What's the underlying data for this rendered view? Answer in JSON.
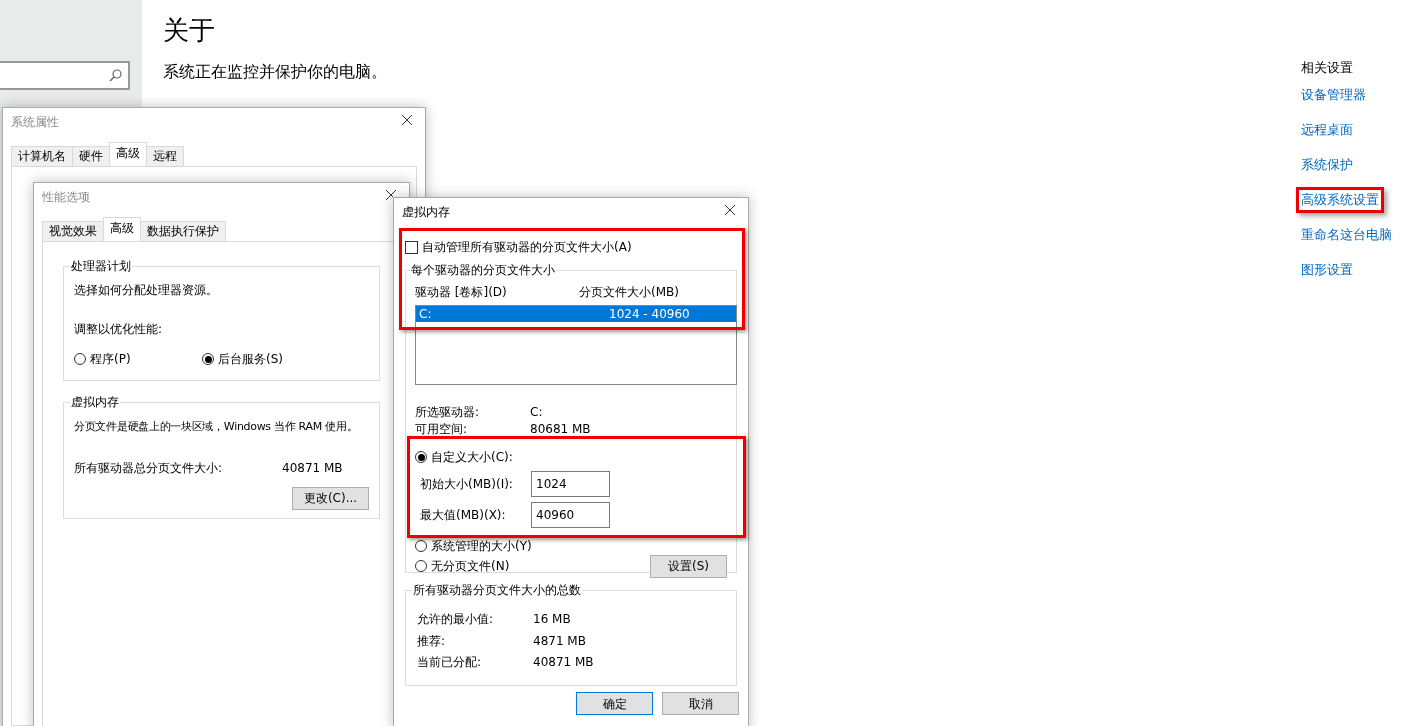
{
  "settings": {
    "title": "关于",
    "subtitle": "系统正在监控并保护你的电脑。",
    "related": {
      "heading": "相关设置",
      "links": [
        {
          "label": "设备管理器",
          "highlighted": false
        },
        {
          "label": "远程桌面",
          "highlighted": false
        },
        {
          "label": "系统保护",
          "highlighted": false
        },
        {
          "label": "高级系统设置",
          "highlighted": true
        },
        {
          "label": "重命名这台电脑",
          "highlighted": false
        },
        {
          "label": "图形设置",
          "highlighted": false
        }
      ]
    }
  },
  "system_properties": {
    "title": "系统属性",
    "tabs": [
      {
        "label": "计算机名",
        "selected": false
      },
      {
        "label": "硬件",
        "selected": false
      },
      {
        "label": "高级",
        "selected": true
      },
      {
        "label": "远程",
        "selected": false
      }
    ]
  },
  "performance_options": {
    "title": "性能选项",
    "tabs": [
      {
        "label": "视觉效果",
        "selected": false
      },
      {
        "label": "高级",
        "selected": true
      },
      {
        "label": "数据执行保护",
        "selected": false
      }
    ],
    "processor": {
      "title": "处理器计划",
      "description": "选择如何分配处理器资源。",
      "adjust_label": "调整以优化性能:",
      "options": [
        {
          "label": "程序(P)",
          "selected": false
        },
        {
          "label": "后台服务(S)",
          "selected": true
        }
      ]
    },
    "virtual_memory": {
      "title": "虚拟内存",
      "description": "分页文件是硬盘上的一块区域，Windows 当作 RAM 使用。",
      "total_label": "所有驱动器总分页文件大小:",
      "total_value": "40871 MB",
      "change_button": "更改(C)..."
    }
  },
  "virtual_memory": {
    "title": "虚拟内存",
    "auto_manage": {
      "label": "自动管理所有驱动器的分页文件大小(A)",
      "checked": false
    },
    "per_drive": {
      "title": "每个驱动器的分页文件大小",
      "highlighted": true,
      "columns": [
        "驱动器 [卷标](D)",
        "分页文件大小(MB)"
      ],
      "drives": [
        {
          "drive": "C:",
          "size": "1024 - 40960",
          "selected": true
        }
      ],
      "info": [
        {
          "label": "所选驱动器:",
          "value": "C:"
        },
        {
          "label": "可用空间:",
          "value": "80681 MB"
        }
      ],
      "size_options": [
        {
          "kind": "custom",
          "label": "自定义大小(C):",
          "selected": true,
          "highlighted": true,
          "fields": [
            {
              "label": "初始大小(MB)(I):",
              "value": "1024"
            },
            {
              "label": "最大值(MB)(X):",
              "value": "40960"
            }
          ]
        },
        {
          "kind": "plain",
          "label": "系统管理的大小(Y)",
          "selected": false
        },
        {
          "kind": "plain",
          "label": "无分页文件(N)",
          "selected": false
        }
      ],
      "set_button": "设置(S)"
    },
    "totals": {
      "title": "所有驱动器分页文件大小的总数",
      "rows": [
        {
          "label": "允许的最小值:",
          "value": "16 MB"
        },
        {
          "label": "推荐:",
          "value": "4871 MB"
        },
        {
          "label": "当前已分配:",
          "value": "40871 MB"
        }
      ]
    },
    "buttons": [
      {
        "label": "确定",
        "kind": "default"
      },
      {
        "label": "取消",
        "kind": "normal"
      }
    ]
  }
}
